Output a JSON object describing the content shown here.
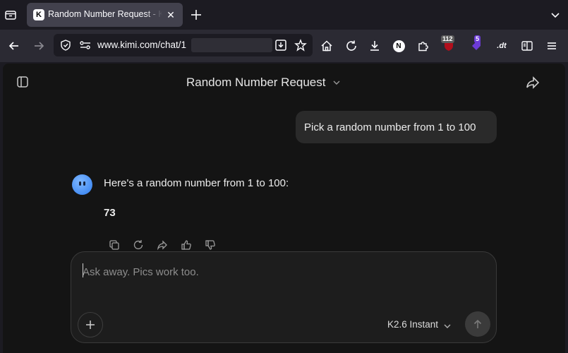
{
  "browser": {
    "tab": {
      "title": "Random Number Request - Kimi",
      "favicon_letter": "K"
    },
    "url": "www.kimi.com/chat/1",
    "extensions": {
      "ublock_count": "112",
      "ext2_count": "5",
      "ext_text": ".dt"
    }
  },
  "header": {
    "title": "Random Number Request"
  },
  "messages": {
    "user": {
      "text": "Pick a random number from 1 to 100"
    },
    "assistant": {
      "intro": "Here's a random number from 1 to 100:",
      "number": "73"
    }
  },
  "composer": {
    "placeholder": "Ask away. Pics work too.",
    "model": "K2.6 Instant"
  },
  "colors": {
    "page_bg": "#141414",
    "bubble": "#2a2a2a",
    "accent": "#2f7df0"
  }
}
